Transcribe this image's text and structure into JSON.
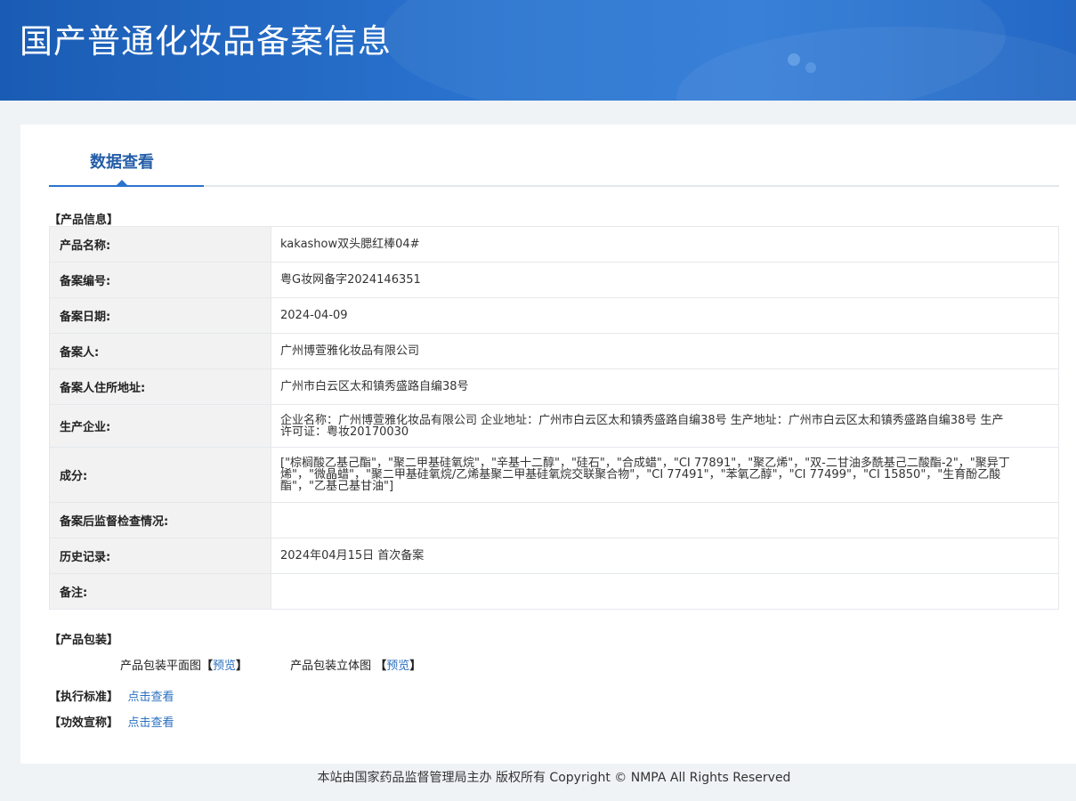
{
  "header": {
    "title": "国产普通化妆品备案信息"
  },
  "tab": {
    "label": "数据查看"
  },
  "product_info": {
    "section_title": "【产品信息】",
    "rows": [
      {
        "label": "产品名称:",
        "value": "kakashow双头腮红棒04#"
      },
      {
        "label": "备案编号:",
        "value": "粤G妆网备字2024146351"
      },
      {
        "label": "备案日期:",
        "value": "2024-04-09"
      },
      {
        "label": "备案人:",
        "value": "广州博萱雅化妆品有限公司"
      },
      {
        "label": "备案人住所地址:",
        "value": "广州市白云区太和镇秀盛路自编38号"
      },
      {
        "label": "生产企业:",
        "value": "企业名称：广州博萱雅化妆品有限公司 企业地址：广州市白云区太和镇秀盛路自编38号 生产地址：广州市白云区太和镇秀盛路自编38号 生产许可证：粤妆20170030"
      },
      {
        "label": "成分:",
        "value": "[\"棕榈酸乙基己酯\"，\"聚二甲基硅氧烷\"，\"辛基十二醇\"，\"硅石\"，\"合成蜡\"，\"CI 77891\"，\"聚乙烯\"，\"双-二甘油多酰基己二酸酯-2\"，\"聚异丁烯\"，\"微晶蜡\"，\"聚二甲基硅氧烷/乙烯基聚二甲基硅氧烷交联聚合物\"，\"CI 77491\"，\"苯氧乙醇\"，\"CI 77499\"，\"CI 15850\"，\"生育酚乙酸酯\"，\"乙基己基甘油\"]"
      },
      {
        "label": "备案后监督检查情况:",
        "value": ""
      },
      {
        "label": "历史记录:",
        "value": "2024年04月15日 首次备案"
      },
      {
        "label": "备注:",
        "value": ""
      }
    ]
  },
  "packaging": {
    "section_title": "【产品包装】",
    "flat_label": "产品包装平面图",
    "flat_link": "预览",
    "solid_label": "产品包装立体图",
    "solid_link": "预览",
    "open_bracket": "【",
    "close_bracket": "】"
  },
  "standard": {
    "section_title": "【执行标准】",
    "link": "点击查看"
  },
  "efficacy": {
    "section_title": "【功效宣称】",
    "link": "点击查看"
  },
  "footer": {
    "text": "本站由国家药品监督管理局主办 版权所有 Copyright © NMPA All Rights Reserved"
  }
}
